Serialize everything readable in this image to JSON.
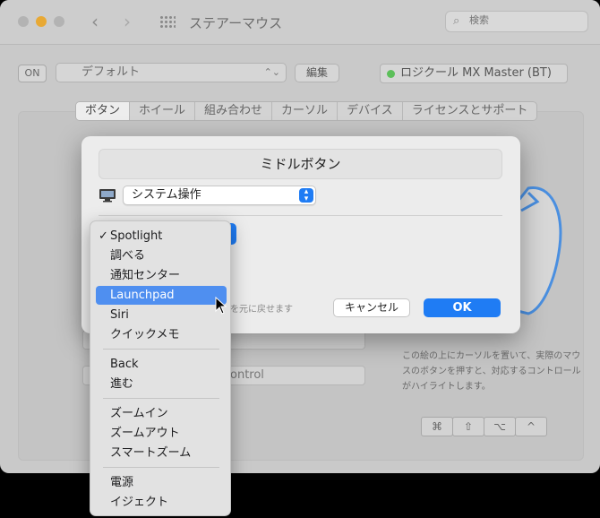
{
  "window": {
    "title": "ステアーマウス"
  },
  "search": {
    "placeholder": "検索"
  },
  "toolbar": {
    "on_label": "ON",
    "profile": "デフォルト",
    "edit_label": "編集",
    "device": "ロジクール MX Master (BT)"
  },
  "tabs": [
    "ボタン",
    "ホイール",
    "組み合わせ",
    "カーソル",
    "デバイス",
    "ライセンスとサポート"
  ],
  "background": {
    "field2_value": "ontrol",
    "hint": "この絵の上にカーソルを置いて、実際のマウスのボタンを押すと、対応するコントロールがハイライトします。",
    "modifier_keys": [
      "⌘",
      "⇧",
      "⌥",
      "^"
    ]
  },
  "dialog": {
    "title": "ミドルボタン",
    "action_select": "システム操作",
    "restore_text": "を元に戻せます",
    "cancel_label": "キャンセル",
    "ok_label": "OK"
  },
  "menu": {
    "groups": [
      [
        "Spotlight",
        "調べる",
        "通知センター",
        "Launchpad",
        "Siri",
        "クイックメモ"
      ],
      [
        "Back",
        "進む"
      ],
      [
        "ズームイン",
        "ズームアウト",
        "スマートズーム"
      ],
      [
        "電源",
        "イジェクト"
      ]
    ],
    "checked": "Spotlight",
    "highlighted": "Launchpad"
  },
  "colors": {
    "accent": "#1f7cf4",
    "menu_highlight": "#4f8ff0",
    "status_green": "#5cbf5a"
  }
}
